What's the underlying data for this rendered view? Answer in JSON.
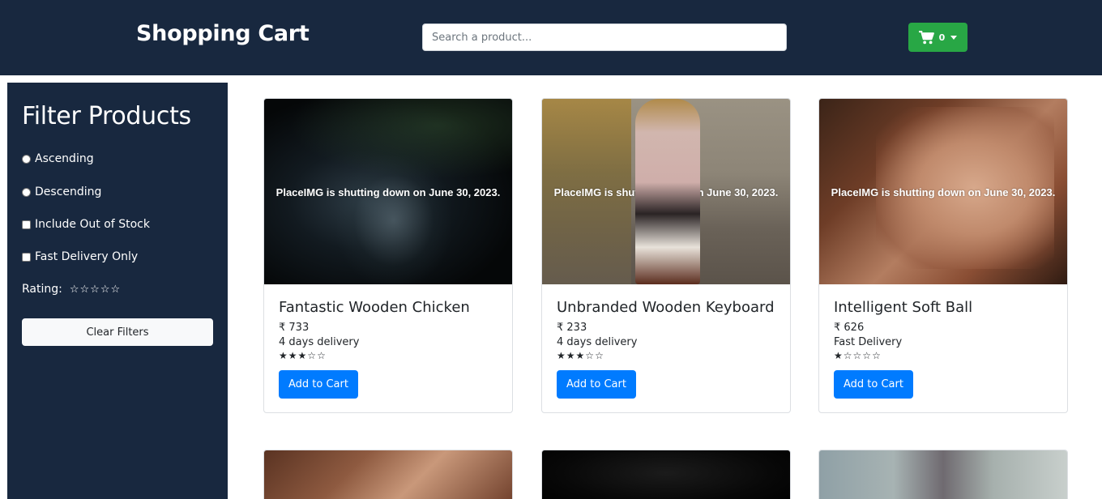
{
  "header": {
    "brand": "Shopping Cart",
    "search_placeholder": "Search a product...",
    "cart_count": "0",
    "colors": {
      "navbar": "#18283f",
      "cart_button": "#28a745"
    }
  },
  "sidebar": {
    "title": "Filter Products",
    "options": {
      "ascending": "Ascending",
      "descending": "Descending",
      "out_of_stock": "Include Out of Stock",
      "fast_delivery": "Fast Delivery Only"
    },
    "rating_label": "Rating:",
    "rating_value": 0,
    "rating_max": 5,
    "clear_label": "Clear Filters"
  },
  "products": [
    {
      "image_text": "PlaceIMG is shutting down on June 30, 2023.",
      "name": "Fantastic Wooden Chicken",
      "price": "₹ 733",
      "delivery": "4 days delivery",
      "rating": 3,
      "button": "Add to Cart"
    },
    {
      "image_text": "PlaceIMG is shutting down on June 30, 2023.",
      "name": "Unbranded Wooden Keyboard",
      "price": "₹ 233",
      "delivery": "4 days delivery",
      "rating": 3,
      "button": "Add to Cart"
    },
    {
      "image_text": "PlaceIMG is shutting down on June 30, 2023.",
      "name": "Intelligent Soft Ball",
      "price": "₹ 626",
      "delivery": "Fast Delivery",
      "rating": 1,
      "button": "Add to Cart"
    }
  ],
  "accent_colors": {
    "primary": "#007bff",
    "light": "#f8f9fa"
  }
}
